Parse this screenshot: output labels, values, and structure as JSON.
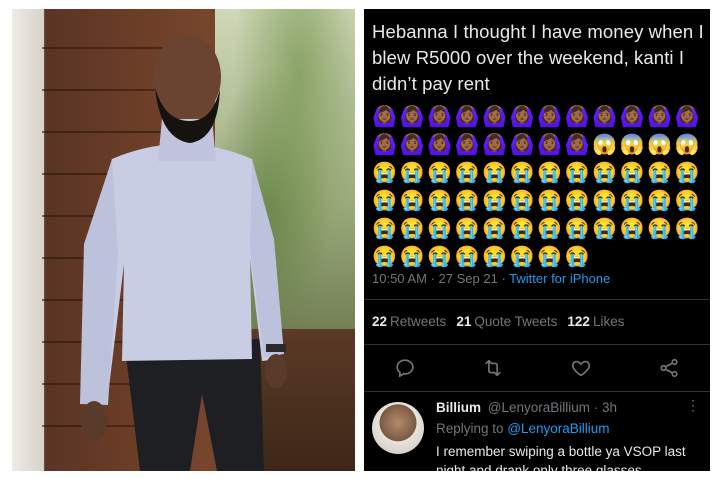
{
  "photo": {
    "alt": "Man in a light grey turtleneck and black trousers standing in front of a wooden wall and a potted palm"
  },
  "tweet": {
    "text": "Hebanna I thought I have money when I blew R5000 over the weekend, kanti I didn’t pay rent",
    "emoji_rows": [
      [
        "🙆🏾‍♀️",
        "🙆🏾‍♀️",
        "🙆🏾‍♀️",
        "🙆🏾‍♀️",
        "🙆🏾‍♀️",
        "🙆🏾‍♀️",
        "🙆🏾‍♀️",
        "🙆🏾‍♀️",
        "🙆🏾‍♀️",
        "🙆🏾‍♀️",
        "🙆🏾‍♀️",
        "🙆🏾‍♀️"
      ],
      [
        "🙆🏾‍♀️",
        "🙆🏾‍♀️",
        "🙆🏾‍♀️",
        "🙆🏾‍♀️",
        "🙆🏾‍♀️",
        "🙆🏾‍♀️",
        "🙆🏾‍♀️",
        "🙆🏾‍♀️",
        "😱",
        "😱",
        "😱",
        "😱"
      ],
      [
        "😭",
        "😭",
        "😭",
        "😭",
        "😭",
        "😭",
        "😭",
        "😭",
        "😭",
        "😭",
        "😭",
        "😭"
      ],
      [
        "😭",
        "😭",
        "😭",
        "😭",
        "😭",
        "😭",
        "😭",
        "😭",
        "😭",
        "😭",
        "😭",
        "😭"
      ],
      [
        "😭",
        "😭",
        "😭",
        "😭",
        "😭",
        "😭",
        "😭",
        "😭",
        "😭",
        "😭",
        "😭",
        "😭"
      ],
      [
        "😭",
        "😭",
        "😭",
        "😭",
        "😭",
        "😭",
        "😭",
        "😭"
      ]
    ],
    "time": "10:50 AM",
    "date": "27 Sep 21",
    "separator": "·",
    "source": "Twitter for iPhone",
    "stats": {
      "retweets_count": "22",
      "retweets_label": "Retweets",
      "quotes_count": "21",
      "quotes_label": "Quote Tweets",
      "likes_count": "122",
      "likes_label": "Likes"
    },
    "actions": [
      "reply-icon",
      "retweet-icon",
      "like-icon",
      "share-icon"
    ],
    "colors": {
      "background": "#000000",
      "text": "#e7e9ea",
      "muted": "#71767b",
      "link": "#1d9bf0",
      "divider": "#2f3336"
    }
  },
  "reply": {
    "name": "Billium",
    "handle": "@LenyoraBillium",
    "age": "· 3h",
    "more": "⋮",
    "replying_label": "Replying to",
    "replying_handle": "@LenyoraBillium",
    "text": "I remember swiping a bottle ya VSOP last night and drank only three glasses"
  }
}
